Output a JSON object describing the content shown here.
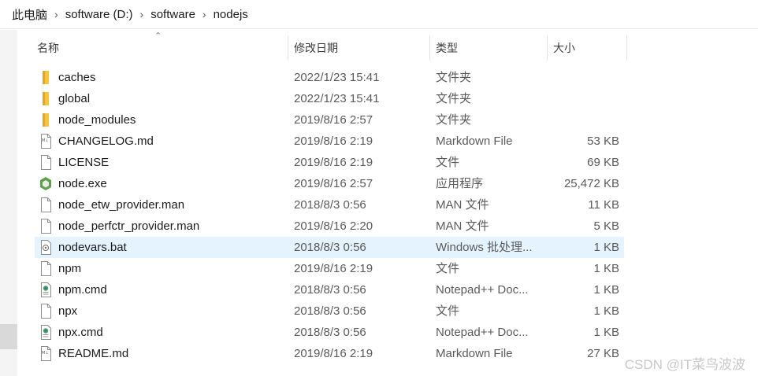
{
  "breadcrumb": [
    "此电脑",
    "software (D:)",
    "software",
    "nodejs"
  ],
  "columns": {
    "name": "名称",
    "date": "修改日期",
    "type": "类型",
    "size": "大小"
  },
  "files": [
    {
      "name": "caches",
      "date": "2022/1/23 15:41",
      "type": "文件夹",
      "size": "",
      "icon": "folder-icon"
    },
    {
      "name": "global",
      "date": "2022/1/23 15:41",
      "type": "文件夹",
      "size": "",
      "icon": "folder-icon"
    },
    {
      "name": "node_modules",
      "date": "2019/8/16 2:57",
      "type": "文件夹",
      "size": "",
      "icon": "folder-icon"
    },
    {
      "name": "CHANGELOG.md",
      "date": "2019/8/16 2:19",
      "type": "Markdown File",
      "size": "53 KB",
      "icon": "markdown-file-icon"
    },
    {
      "name": "LICENSE",
      "date": "2019/8/16 2:19",
      "type": "文件",
      "size": "69 KB",
      "icon": "file-icon"
    },
    {
      "name": "node.exe",
      "date": "2019/8/16 2:57",
      "type": "应用程序",
      "size": "25,472 KB",
      "icon": "nodejs-icon"
    },
    {
      "name": "node_etw_provider.man",
      "date": "2018/8/3 0:56",
      "type": "MAN 文件",
      "size": "11 KB",
      "icon": "file-icon"
    },
    {
      "name": "node_perfctr_provider.man",
      "date": "2019/8/16 2:20",
      "type": "MAN 文件",
      "size": "5 KB",
      "icon": "file-icon"
    },
    {
      "name": "nodevars.bat",
      "date": "2018/8/3 0:56",
      "type": "Windows 批处理...",
      "size": "1 KB",
      "icon": "batch-file-icon",
      "selected": true
    },
    {
      "name": "npm",
      "date": "2019/8/16 2:19",
      "type": "文件",
      "size": "1 KB",
      "icon": "file-icon"
    },
    {
      "name": "npm.cmd",
      "date": "2018/8/3 0:56",
      "type": "Notepad++ Doc...",
      "size": "1 KB",
      "icon": "notepadpp-file-icon"
    },
    {
      "name": "npx",
      "date": "2018/8/3 0:56",
      "type": "文件",
      "size": "1 KB",
      "icon": "file-icon"
    },
    {
      "name": "npx.cmd",
      "date": "2018/8/3 0:56",
      "type": "Notepad++ Doc...",
      "size": "1 KB",
      "icon": "notepadpp-file-icon"
    },
    {
      "name": "README.md",
      "date": "2019/8/16 2:19",
      "type": "Markdown File",
      "size": "27 KB",
      "icon": "markdown-file-icon"
    }
  ],
  "watermark": "CSDN @IT菜鸟波波",
  "colors": {
    "selected_row": "#e5f3ff",
    "folder": "#f4c542",
    "node_green": "#5fa04e"
  }
}
